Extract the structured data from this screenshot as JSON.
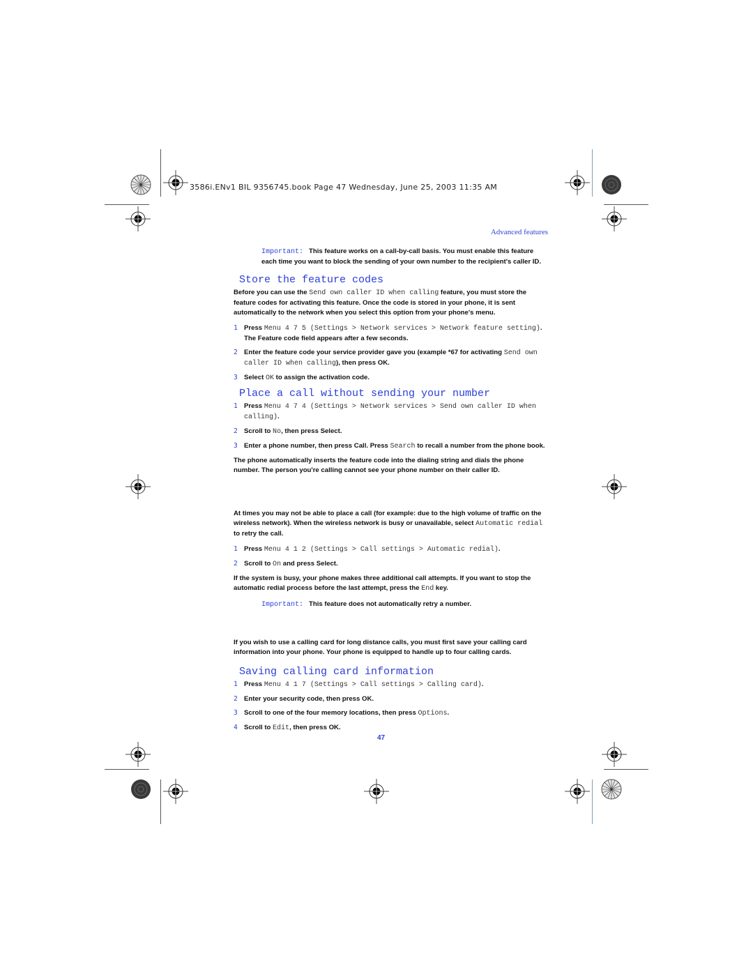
{
  "slug": "3586i.ENv1 BIL  9356745.book  Page 47  Wednesday, June 25, 2003  11:35 AM",
  "running_head": "Advanced features",
  "page_number": "47",
  "colors": {
    "accent": "#2a3fd6",
    "text": "#111111"
  },
  "note1": {
    "label": "Important:",
    "text": "This feature works on a call-by-call basis. You must enable this feature each time you want to block the sending of your own number to the recipient's caller ID."
  },
  "section_store": {
    "heading": "Store the feature codes",
    "intro_pre": "Before you can use the ",
    "intro_term": "Send own caller ID when calling",
    "intro_post": " feature, you must store the feature codes for activating this feature. Once the code is stored in your phone, it is sent automatically to the network when you select this option from your phone's menu.",
    "steps": [
      {
        "num": "1",
        "pre": "Press ",
        "mono": "Menu 4 7 5 (Settings > Network services > Network feature setting)",
        "post": ". The Feature code field appears after a few seconds."
      },
      {
        "num": "2",
        "pre": "Enter the feature code your service provider gave you (example *67  for activating ",
        "mono": "Send own caller ID when calling",
        "post": "), then press OK."
      },
      {
        "num": "3",
        "pre": "Select ",
        "mono": "OK",
        "post": " to assign the activation code."
      }
    ]
  },
  "section_place": {
    "heading": "Place a call without sending your number",
    "steps": [
      {
        "num": "1",
        "pre": "Press ",
        "mono": "Menu 4 7 4 (Settings > Network services > Send own caller ID when calling)",
        "post": "."
      },
      {
        "num": "2",
        "pre": "Scroll to ",
        "mono": "No",
        "post": ", then press Select."
      },
      {
        "num": "3",
        "pre": "Enter a phone number, then press Call. Press ",
        "mono": "Search",
        "post": " to recall a number from the phone book."
      }
    ],
    "outro": "The phone automatically inserts the feature code into the dialing string and dials the phone number. The person you're calling cannot see your phone number on their caller ID."
  },
  "section_redial": {
    "intro_pre": "At times you may not be able to place a call (for example: due to the high volume of traffic on the wireless network). When the wireless network is busy or unavailable, select ",
    "intro_term": "Automatic redial",
    "intro_post": " to retry the call.",
    "steps": [
      {
        "num": "1",
        "pre": "Press ",
        "mono": "Menu 4 1 2 (Settings > Call settings > Automatic redial)",
        "post": "."
      },
      {
        "num": "2",
        "pre": "Scroll to ",
        "mono": "On",
        "post": " and press Select."
      }
    ],
    "outro_pre": "If the system is busy, your phone makes three additional call attempts. If you want to stop the automatic redial process before the last attempt, press the ",
    "outro_term": "End",
    "outro_post": " key."
  },
  "note2": {
    "label": "Important:",
    "text": "This feature does not automatically retry a number."
  },
  "section_card_intro": "If you wish to use a calling card for long distance calls, you must first save your calling card information into your phone. Your phone is equipped to handle up to four calling cards.",
  "section_save": {
    "heading": "Saving calling card information",
    "steps": [
      {
        "num": "1",
        "pre": "Press ",
        "mono": "Menu 4 1 7 (Settings > Call settings > Calling card)",
        "post": "."
      },
      {
        "num": "2",
        "pre": "Enter your security code, then press OK.",
        "mono": "",
        "post": ""
      },
      {
        "num": "3",
        "pre": "Scroll to one of the four memory locations, then press ",
        "mono": "Options",
        "post": "."
      },
      {
        "num": "4",
        "pre": "Scroll to ",
        "mono": "Edit",
        "post": ", then press OK."
      }
    ]
  }
}
